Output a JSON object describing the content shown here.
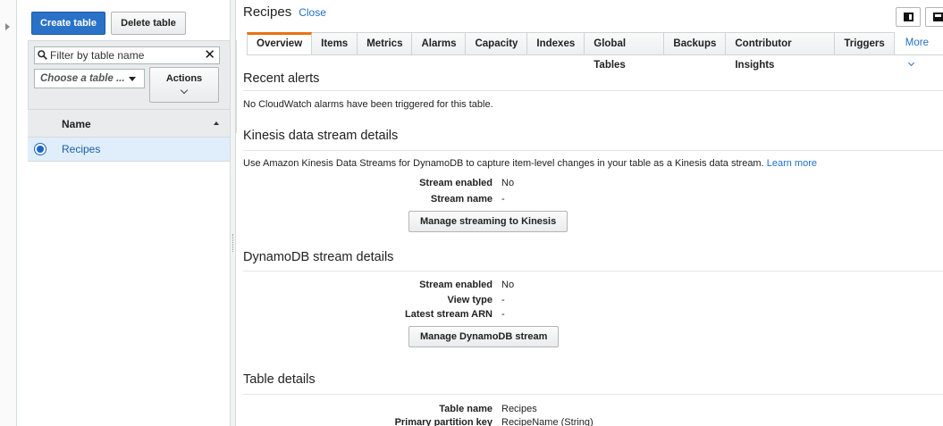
{
  "left": {
    "create_label": "Create table",
    "delete_label": "Delete table",
    "filter_placeholder": "Filter by table name",
    "clear_symbol": "✕",
    "choose_label": "Choose a table ...",
    "actions_label": "Actions",
    "table_header": "Name",
    "tables": [
      {
        "name": "Recipes",
        "selected": true
      }
    ]
  },
  "header": {
    "title": "Recipes",
    "close_label": "Close"
  },
  "tabs": [
    "Overview",
    "Items",
    "Metrics",
    "Alarms",
    "Capacity",
    "Indexes",
    "Global Tables",
    "Backups",
    "Contributor Insights",
    "Triggers"
  ],
  "more_label": "More",
  "alerts": {
    "title": "Recent alerts",
    "text": "No CloudWatch alarms have been triggered for this table."
  },
  "kinesis": {
    "title": "Kinesis data stream details",
    "text": "Use Amazon Kinesis Data Streams for DynamoDB to capture item-level changes in your table as a Kinesis data stream.",
    "learn_more": "Learn more",
    "rows": [
      {
        "label": "Stream enabled",
        "value": "No"
      },
      {
        "label": "Stream name",
        "value": "-"
      }
    ],
    "button": "Manage streaming to Kinesis"
  },
  "dynamo": {
    "title": "DynamoDB stream details",
    "rows": [
      {
        "label": "Stream enabled",
        "value": "No"
      },
      {
        "label": "View type",
        "value": "-"
      },
      {
        "label": "Latest stream ARN",
        "value": "-"
      }
    ],
    "button": "Manage DynamoDB stream"
  },
  "details": {
    "title": "Table details",
    "rows": [
      {
        "label": "Table name",
        "value": "Recipes"
      },
      {
        "label": "Primary partition key",
        "value": "RecipeName (String)"
      }
    ]
  },
  "colors": {
    "primary": "#2a72c7",
    "tab_accent": "#ec7211",
    "link": "#1f6fc5",
    "selected_row": "#dfeefa"
  },
  "icons": [
    "expand-rail-icon",
    "search-icon",
    "clear-icon",
    "dropdown-icon",
    "chevron-down-icon",
    "sort-asc-icon",
    "split-view-icon",
    "bottom-view-icon"
  ]
}
